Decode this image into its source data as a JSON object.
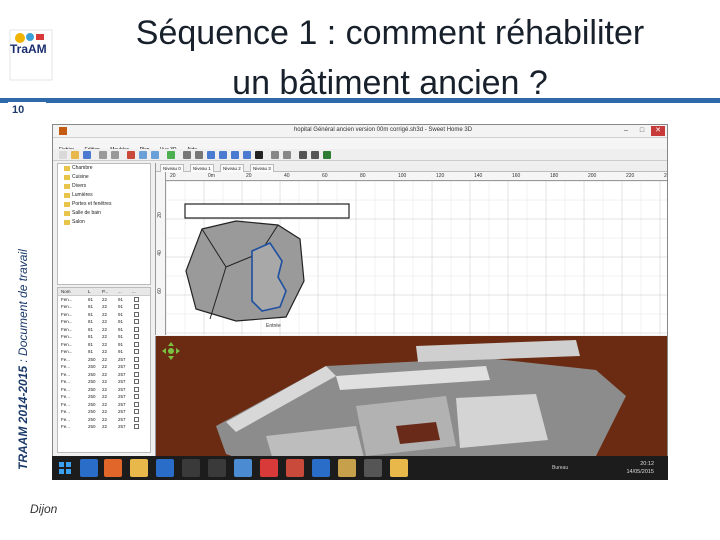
{
  "slide": {
    "title_line1": "Séquence 1 : comment réhabiliter",
    "title_line2": "un bâtiment ancien ?",
    "slide_number": "10",
    "side_text_bold": "TRAAM 2014-2015",
    "side_text_rest": " : Document de travail",
    "footer": "Dijon",
    "logo_text": "TraAM",
    "accent_color": "#2e6aa9"
  },
  "app": {
    "window_title": "hopital Général ancien version 00m corrigé.sh3d - Sweet Home 3D",
    "window_controls": [
      "–",
      "□",
      "✕"
    ],
    "menu": [
      "Fichier",
      "Edition",
      "Meubles",
      "Plan",
      "Vue 3D",
      "Aide"
    ],
    "catalog": [
      "Chambre",
      "Cuisine",
      "Divers",
      "Lumières",
      "Portes et fenêtres",
      "Salle de bain",
      "Salon"
    ],
    "furniture_columns": [
      "Nom",
      "L",
      "P...",
      "...",
      "..."
    ],
    "furniture_rows": [
      [
        "Fen...",
        "81",
        "22",
        "91"
      ],
      [
        "Fen...",
        "81",
        "22",
        "91"
      ],
      [
        "Fen...",
        "81",
        "22",
        "91"
      ],
      [
        "Fen...",
        "81",
        "22",
        "91"
      ],
      [
        "Fen...",
        "81",
        "22",
        "91"
      ],
      [
        "Fen...",
        "81",
        "22",
        "91"
      ],
      [
        "Fen...",
        "81",
        "22",
        "91"
      ],
      [
        "Fen...",
        "81",
        "22",
        "91"
      ],
      [
        "Fe...",
        "250",
        "22",
        "257"
      ],
      [
        "Fe...",
        "250",
        "22",
        "257"
      ],
      [
        "Fe...",
        "250",
        "22",
        "257"
      ],
      [
        "Fe...",
        "250",
        "22",
        "257"
      ],
      [
        "Fe...",
        "250",
        "22",
        "257"
      ],
      [
        "Fe...",
        "250",
        "22",
        "257"
      ],
      [
        "Fe...",
        "250",
        "22",
        "257"
      ],
      [
        "Fe...",
        "250",
        "22",
        "257"
      ],
      [
        "Fe...",
        "250",
        "22",
        "257"
      ],
      [
        "Fe...",
        "250",
        "22",
        "257"
      ]
    ],
    "level_tabs": [
      "Niveau 0",
      "Niveau 1",
      "Niveau 2",
      "Niveau 3"
    ],
    "ruler_x": [
      "20",
      "0m",
      "20",
      "40",
      "60",
      "80",
      "100",
      "120",
      "140",
      "160",
      "180",
      "200",
      "220",
      "24"
    ],
    "ruler_y": [
      "20",
      "40",
      "60"
    ],
    "room_label": "Entrée",
    "taskbar_label": "Bureau",
    "clock_time": "20:12",
    "clock_date": "14/05/2015"
  }
}
